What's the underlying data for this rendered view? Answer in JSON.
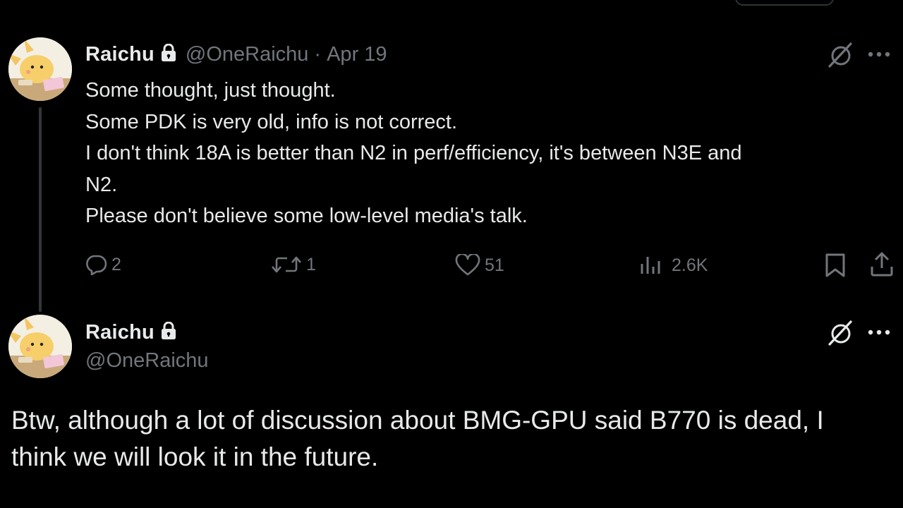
{
  "tweet1": {
    "author_name": "Raichu",
    "handle": "@OneRaichu",
    "separator": "·",
    "date": "Apr 19",
    "text_lines": [
      "Some thought, just thought.",
      "Some PDK is very old, info is not correct.",
      "I don't think 18A is better than N2 in perf/efficiency, it's between N3E and",
      "N2.",
      "Please don't believe some low-level media's talk."
    ],
    "actions": {
      "replies": "2",
      "reposts": "1",
      "likes": "51",
      "views": "2.6K"
    },
    "icons": {
      "lock": "lock-icon",
      "grok": "grok-icon",
      "more": "more-icon",
      "reply": "reply-icon",
      "repost": "repost-icon",
      "like": "heart-icon",
      "views": "views-icon",
      "bookmark": "bookmark-icon",
      "share": "share-icon"
    }
  },
  "tweet2": {
    "author_name": "Raichu",
    "handle": "@OneRaichu",
    "text_lines": [
      "Btw, although a lot of discussion about BMG-GPU said B770 is dead, I",
      "think we will look it in the future."
    ]
  },
  "colors": {
    "background": "#000000",
    "text_primary": "#e7e9ea",
    "text_secondary": "#71767b",
    "thread_line": "#333639"
  }
}
